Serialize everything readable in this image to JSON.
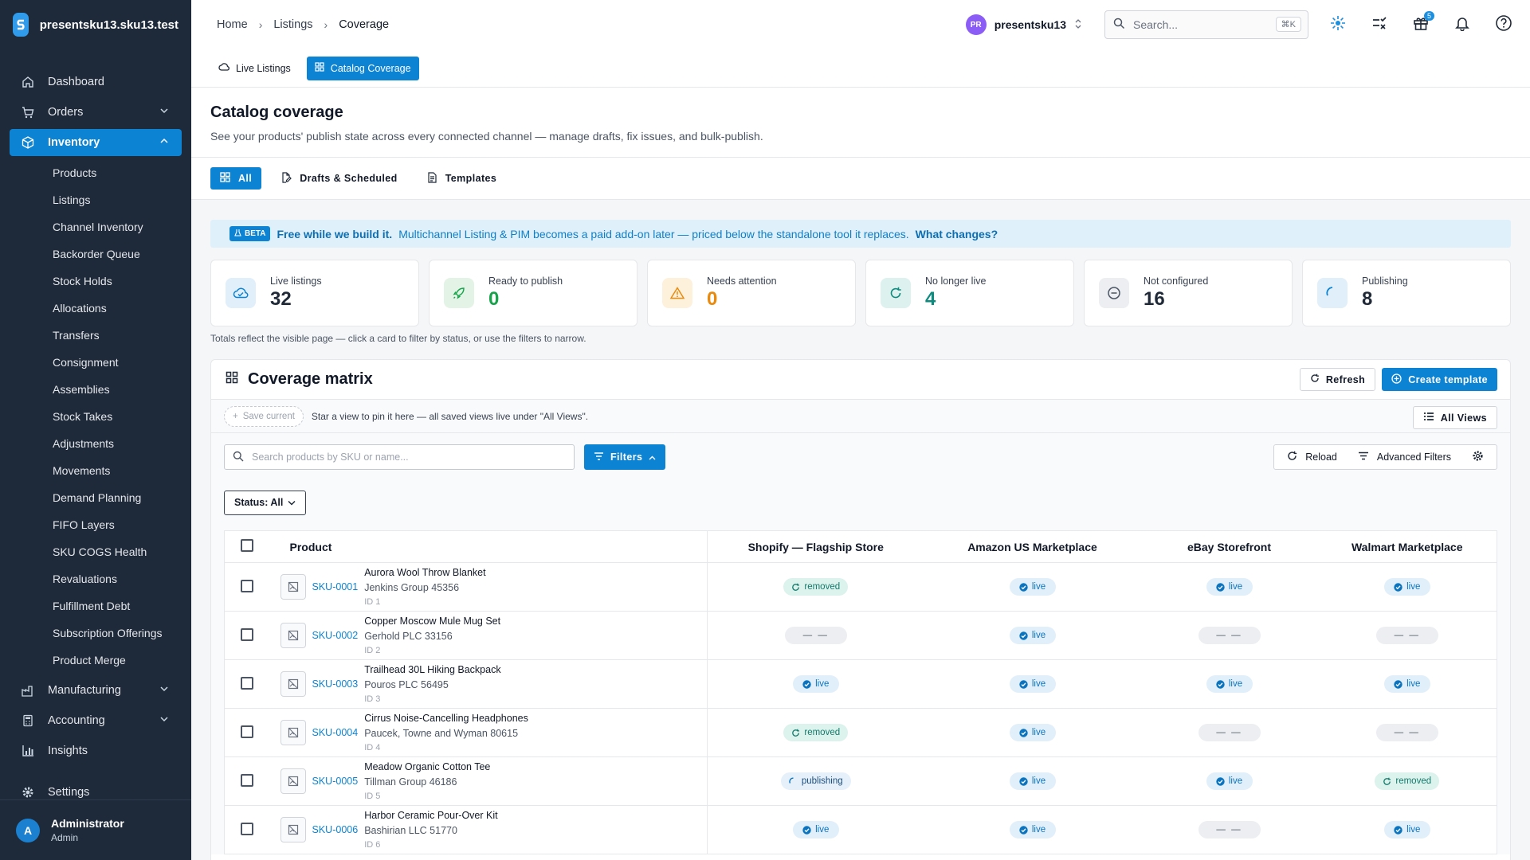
{
  "brand": {
    "name": "presentsku13.sku13.test"
  },
  "nav": {
    "dashboard": "Dashboard",
    "orders": "Orders",
    "inventory": "Inventory",
    "sub": [
      "Products",
      "Listings",
      "Channel Inventory",
      "Backorder Queue",
      "Stock Holds",
      "Allocations",
      "Transfers",
      "Consignment",
      "Assemblies",
      "Stock Takes",
      "Adjustments",
      "Movements",
      "Demand Planning",
      "FIFO Layers",
      "SKU COGS Health",
      "Revaluations",
      "Fulfillment Debt",
      "Subscription Offerings",
      "Product Merge"
    ],
    "manufacturing": "Manufacturing",
    "accounting": "Accounting",
    "insights": "Insights",
    "settings": "Settings"
  },
  "user": {
    "initial": "A",
    "name": "Administrator",
    "role": "Admin"
  },
  "breadcrumb": {
    "home": "Home",
    "listings": "Listings",
    "coverage": "Coverage"
  },
  "store": {
    "initials": "PR",
    "name": "presentsku13"
  },
  "search": {
    "placeholder": "Search...",
    "shortcut": "⌘K"
  },
  "notifications": {
    "gift_count": "5"
  },
  "subtabs": {
    "live": "Live Listings",
    "catalog": "Catalog Coverage"
  },
  "page": {
    "title": "Catalog coverage",
    "description": "See your products' publish state across every connected channel — manage drafts, fix issues, and bulk-publish."
  },
  "viewtabs": {
    "all": "All",
    "drafts": "Drafts & Scheduled",
    "templates": "Templates"
  },
  "beta": {
    "tag": "BETA",
    "strong": "Free while we build it.",
    "text": "Multichannel Listing & PIM becomes a paid add-on later — priced below the standalone tool it replaces.",
    "link": "What changes?"
  },
  "stats": [
    {
      "label": "Live listings",
      "value": "32",
      "color": "#111827"
    },
    {
      "label": "Ready to publish",
      "value": "0",
      "color": "#16a34a"
    },
    {
      "label": "Needs attention",
      "value": "0",
      "color": "#ea8a0c"
    },
    {
      "label": "No longer live",
      "value": "4",
      "color": "#0f8a7e"
    },
    {
      "label": "Not configured",
      "value": "16",
      "color": "#111827"
    },
    {
      "label": "Publishing",
      "value": "8",
      "color": "#111827"
    }
  ],
  "stats_note": "Totals reflect the visible page — click a card to filter by status, or use the filters to narrow.",
  "matrix": {
    "title": "Coverage matrix",
    "refresh": "Refresh",
    "create": "Create template",
    "save_current": "Save current",
    "views_hint": "Star a view to pin it here — all saved views live under \"All Views\".",
    "all_views": "All Views",
    "search_placeholder": "Search products by SKU or name...",
    "filters": "Filters",
    "reload": "Reload",
    "advanced": "Advanced Filters",
    "status": "Status: All"
  },
  "table": {
    "columns": [
      "Product",
      "Shopify — Flagship Store",
      "Amazon US Marketplace",
      "eBay Storefront",
      "Walmart Marketplace"
    ],
    "rows": [
      {
        "sku": "SKU-0001",
        "name": "Aurora Wool Throw Blanket",
        "sub": "Jenkins Group 45356",
        "id": "ID 1",
        "states": [
          "removed",
          "live",
          "live",
          "live"
        ]
      },
      {
        "sku": "SKU-0002",
        "name": "Copper Moscow Mule Mug Set",
        "sub": "Gerhold PLC 33156",
        "id": "ID 2",
        "states": [
          "none",
          "live",
          "none",
          "none"
        ]
      },
      {
        "sku": "SKU-0003",
        "name": "Trailhead 30L Hiking Backpack",
        "sub": "Pouros PLC 56495",
        "id": "ID 3",
        "states": [
          "live",
          "live",
          "live",
          "live"
        ]
      },
      {
        "sku": "SKU-0004",
        "name": "Cirrus Noise-Cancelling Headphones",
        "sub": "Paucek, Towne and Wyman 80615",
        "id": "ID 4",
        "states": [
          "removed",
          "live",
          "none",
          "none"
        ]
      },
      {
        "sku": "SKU-0005",
        "name": "Meadow Organic Cotton Tee",
        "sub": "Tillman Group 46186",
        "id": "ID 5",
        "states": [
          "publishing",
          "live",
          "live",
          "removed"
        ]
      },
      {
        "sku": "SKU-0006",
        "name": "Harbor Ceramic Pour-Over Kit",
        "sub": "Bashirian LLC 51770",
        "id": "ID 6",
        "states": [
          "live",
          "live",
          "none",
          "live"
        ]
      }
    ],
    "labels": {
      "live": "live",
      "removed": "removed",
      "publishing": "publishing",
      "none": "— —"
    }
  }
}
